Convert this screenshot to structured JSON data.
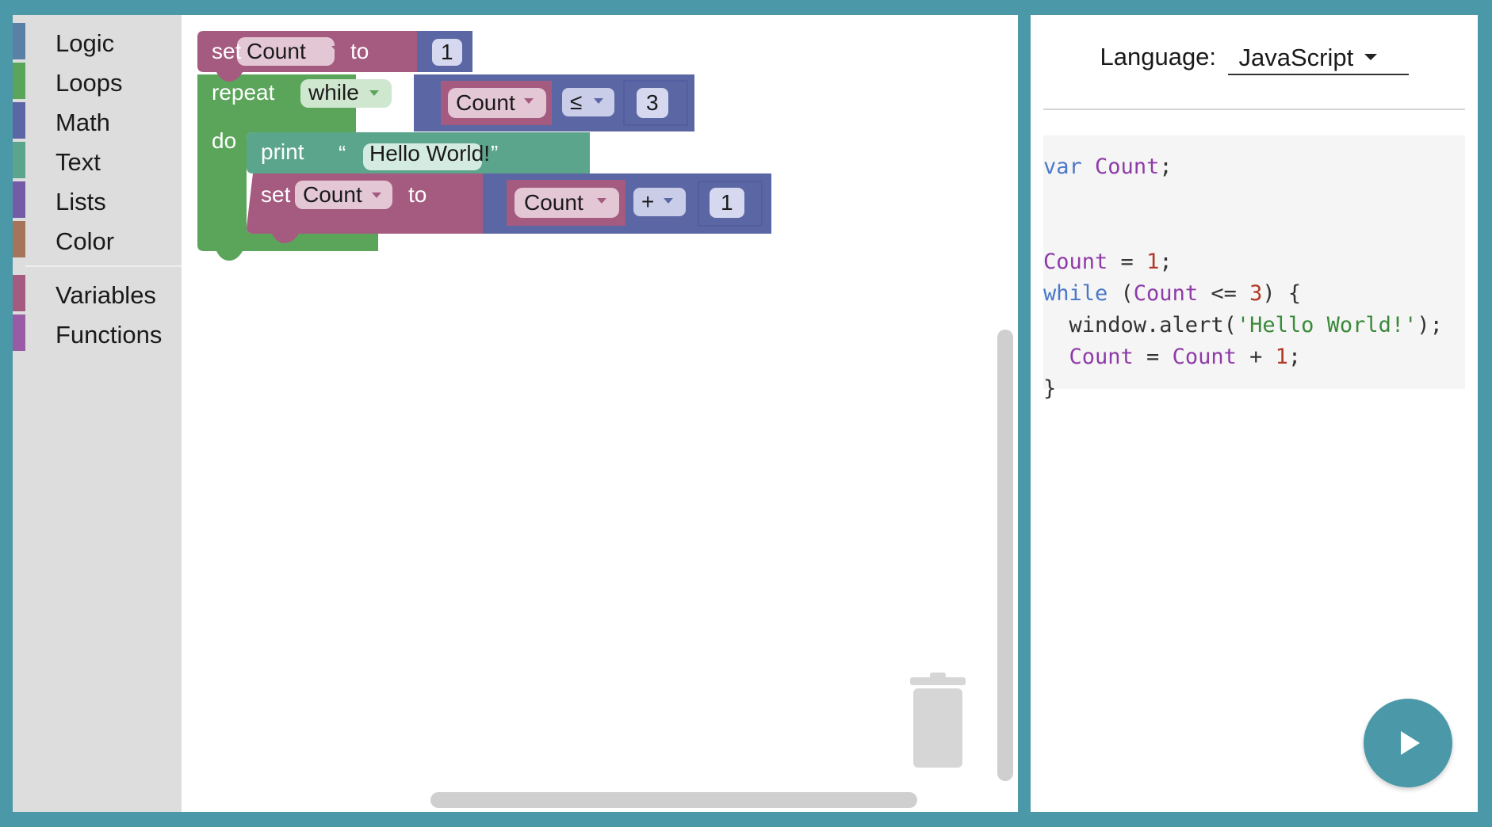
{
  "toolbox": {
    "categories": [
      {
        "label": "Logic",
        "color": "#5b80a5"
      },
      {
        "label": "Loops",
        "color": "#5ba55b"
      },
      {
        "label": "Math",
        "color": "#5b67a5"
      },
      {
        "label": "Text",
        "color": "#5ba58c"
      },
      {
        "label": "Lists",
        "color": "#745ba5"
      },
      {
        "label": "Color",
        "color": "#a5745b"
      }
    ],
    "categories2": [
      {
        "label": "Variables",
        "color": "#a55b80"
      },
      {
        "label": "Functions",
        "color": "#995ba5"
      }
    ]
  },
  "blocks": {
    "set1": {
      "set": "set",
      "var": "Count",
      "to": "to",
      "value": "1"
    },
    "repeat": {
      "repeat": "repeat",
      "mode": "while",
      "do": "do"
    },
    "compare": {
      "var": "Count",
      "op": "≤",
      "value": "3"
    },
    "print": {
      "print": "print",
      "open_quote": "“",
      "text": "Hello World!",
      "close_quote": "”"
    },
    "set2": {
      "set": "set",
      "var": "Count",
      "to": "to"
    },
    "arith": {
      "var": "Count",
      "op": "+",
      "value": "1"
    },
    "colors": {
      "variables": "#a55b80",
      "loops": "#5ba55b",
      "math": "#5b67a5",
      "text": "#5ba58c"
    }
  },
  "code_panel": {
    "language_label": "Language:",
    "language_value": "JavaScript",
    "lines": [
      [
        {
          "t": "var",
          "c": "kw"
        },
        {
          "t": " "
        },
        {
          "t": "Count",
          "c": "var"
        },
        {
          "t": ";"
        }
      ],
      [],
      [],
      [
        {
          "t": "Count",
          "c": "var"
        },
        {
          "t": " = "
        },
        {
          "t": "1",
          "c": "num"
        },
        {
          "t": ";"
        }
      ],
      [
        {
          "t": "while",
          "c": "kw"
        },
        {
          "t": " ("
        },
        {
          "t": "Count",
          "c": "var"
        },
        {
          "t": " <= "
        },
        {
          "t": "3",
          "c": "num"
        },
        {
          "t": ") {"
        }
      ],
      [
        {
          "t": "  window.alert("
        },
        {
          "t": "'Hello World!'",
          "c": "str"
        },
        {
          "t": ");"
        }
      ],
      [
        {
          "t": "  "
        },
        {
          "t": "Count",
          "c": "var"
        },
        {
          "t": " = "
        },
        {
          "t": "Count",
          "c": "var"
        },
        {
          "t": " + "
        },
        {
          "t": "1",
          "c": "num"
        },
        {
          "t": ";"
        }
      ],
      [
        {
          "t": "}"
        }
      ]
    ]
  }
}
